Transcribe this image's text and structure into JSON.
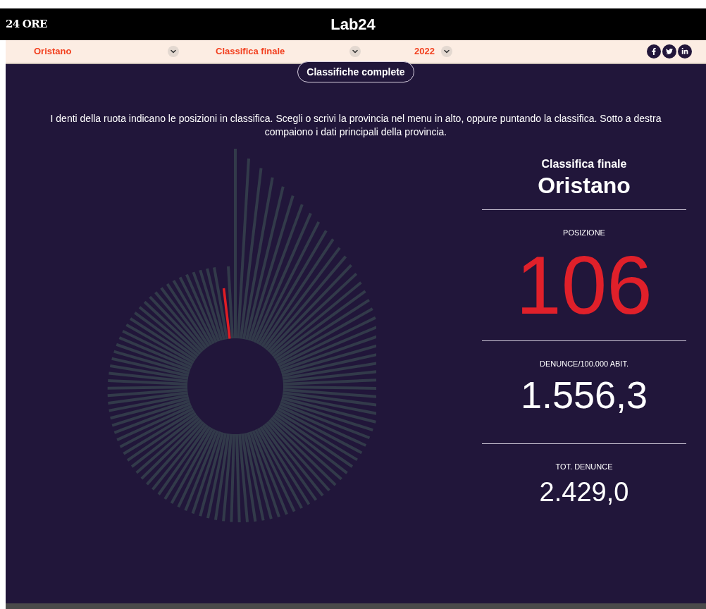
{
  "header": {
    "left_logo": "24 ORE",
    "center_logo": "Lab24"
  },
  "filters": [
    {
      "value": "Oristano"
    },
    {
      "value": "Classifica finale"
    },
    {
      "value": "2022"
    }
  ],
  "share": [
    {
      "kind": "facebook"
    },
    {
      "kind": "twitter"
    },
    {
      "kind": "linkedin"
    }
  ],
  "full_rankings_button": "Classifiche complete",
  "intro": "I denti della ruota indicano le posizioni in classifica. Scegli o scrivi la provincia nel menu in alto, oppure puntando la classifica. Sotto a destra compaiono i dati principali della provincia.",
  "detail": {
    "ranking": "Classifica finale",
    "province": "Oristano",
    "stats": [
      {
        "label": "POSIZIONE",
        "value": "106",
        "kind": "rank"
      },
      {
        "label": "DENUNCE/100.000 ABIT.",
        "value": "1.556,3",
        "kind": "big"
      },
      {
        "label": "TOT. DENUNCE",
        "value": "2.429,0",
        "kind": "small"
      }
    ]
  }
}
